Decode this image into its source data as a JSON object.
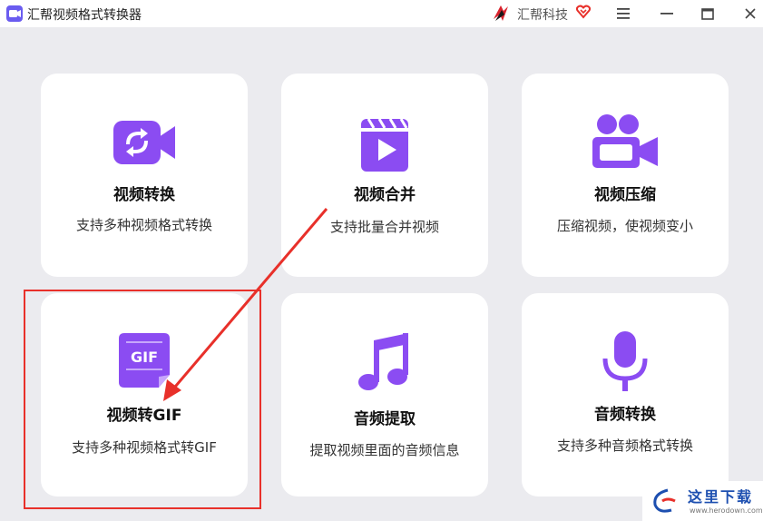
{
  "window": {
    "title": "汇帮视频格式转换器",
    "brand": "汇帮科技",
    "controls": [
      "menu",
      "minimize",
      "maximize",
      "close"
    ]
  },
  "colors": {
    "accent": "#8b4cf2",
    "highlight": "#e8302a",
    "background": "#ebebef",
    "card": "#ffffff"
  },
  "cards": [
    {
      "title": "视频转换",
      "desc": "支持多种视频格式转换",
      "icon": "video-convert-icon"
    },
    {
      "title": "视频合并",
      "desc": "支持批量合并视频",
      "icon": "video-merge-icon"
    },
    {
      "title": "视频压缩",
      "desc": "压缩视频，使视频变小",
      "icon": "video-compress-icon"
    },
    {
      "title": "视频转GIF",
      "desc": "支持多种视频格式转GIF",
      "icon": "gif-icon",
      "icon_text": "GIF"
    },
    {
      "title": "音频提取",
      "desc": "提取视频里面的音频信息",
      "icon": "music-note-icon"
    },
    {
      "title": "音频转换",
      "desc": "支持多种音频格式转换",
      "icon": "microphone-icon"
    }
  ],
  "watermark": {
    "text": "这里下载",
    "url": "www.herodown.com"
  }
}
